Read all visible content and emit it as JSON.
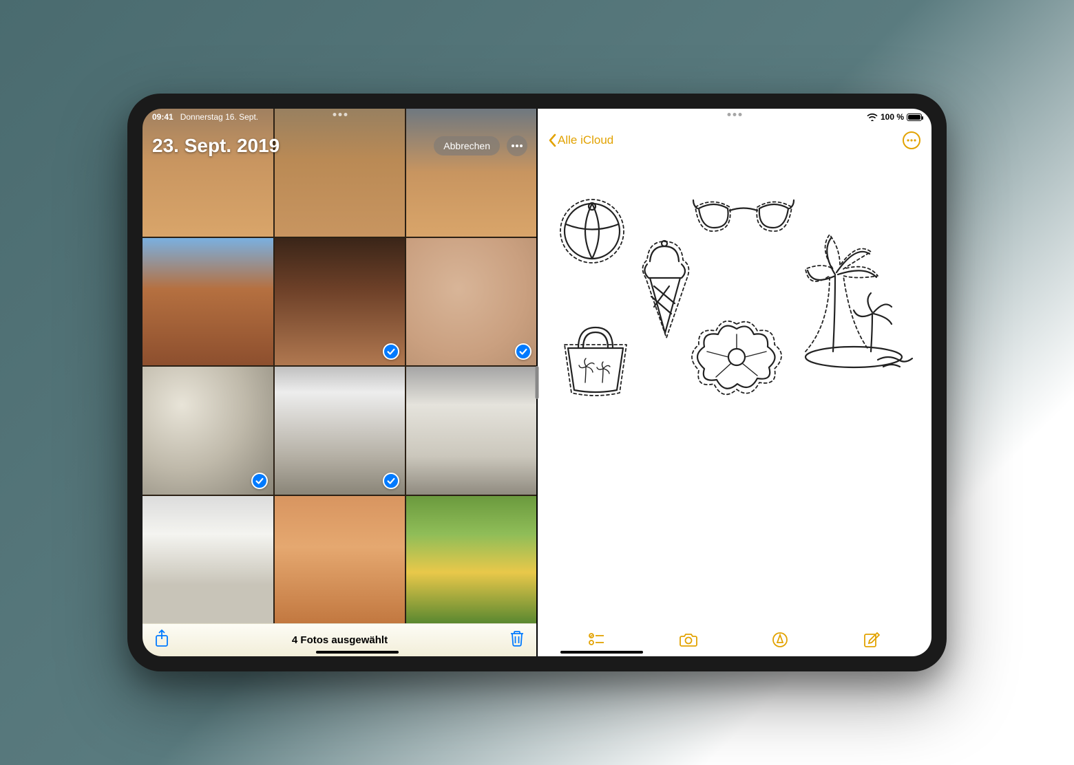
{
  "status_bar": {
    "time": "09:41",
    "date": "Donnerstag 16. Sept.",
    "battery": "100 %"
  },
  "photos": {
    "title": "23. Sept. 2019",
    "cancel": "Abbrechen",
    "selection_status": "4 Fotos ausgewählt",
    "grid": [
      {
        "selected": false
      },
      {
        "selected": false
      },
      {
        "selected": false
      },
      {
        "selected": false
      },
      {
        "selected": true
      },
      {
        "selected": true
      },
      {
        "selected": true
      },
      {
        "selected": true
      },
      {
        "selected": false
      },
      {
        "selected": false
      },
      {
        "selected": false
      },
      {
        "selected": false
      }
    ]
  },
  "notes": {
    "back_label": "Alle iCloud",
    "doodles": [
      "beach-ball",
      "sunglasses",
      "palm-trees",
      "ice-cream",
      "beach-bag",
      "flower"
    ]
  },
  "colors": {
    "ios_blue": "#007aff",
    "notes_yellow": "#e2a200"
  }
}
